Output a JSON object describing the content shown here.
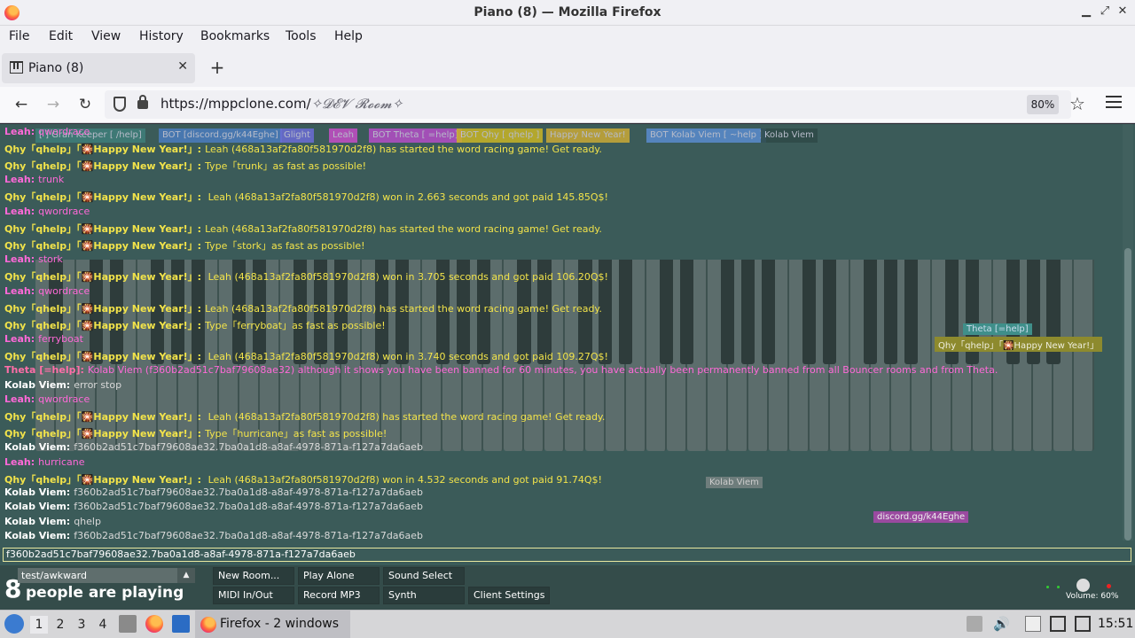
{
  "window": {
    "title": "Piano (8) — Mozilla Firefox"
  },
  "menu": [
    "File",
    "Edit",
    "View",
    "History",
    "Bookmarks",
    "Tools",
    "Help"
  ],
  "tab": {
    "title": "Piano (8)"
  },
  "nav": {
    "url_prefix": "https://mppclone.com/",
    "url_path": "✧𝓓𝓔𝓥 𝓡𝓸𝓸𝓶✧",
    "zoom": "80%"
  },
  "topbar_tags": [
    {
      "label": "[ ] Gran Keeper [ /help]",
      "color": "#3f7f7a"
    },
    {
      "label": "BOT [discord.gg/k44Eghe]",
      "color": "#4b7dbf"
    },
    {
      "label": "Glight",
      "color": "#6c6cd6"
    },
    {
      "label": "Leah",
      "color": "#c54ec7"
    },
    {
      "label": "BOT Theta [ =help]",
      "color": "#b54ec7"
    },
    {
      "label": "BOT Qhy [ qhelp ]",
      "color": "#c9b526"
    },
    {
      "label": "Happy New Year!",
      "color": "#caa936"
    },
    {
      "label": "BOT Kolab Viem [ ~help ]",
      "color": "#5a8ccf"
    },
    {
      "label": "Kolab Viem",
      "color": "#2f4a48"
    }
  ],
  "chat": [
    {
      "sender": "Leah:",
      "type": "leah",
      "message": "qwordrace",
      "style": "pink"
    },
    {
      "sender": "Qhy「qhelp」「🎇Happy New Year!」:",
      "type": "qhy",
      "message": "Leah (468a13af2fa80f581970d2f8) has started the word racing game! Get ready.",
      "style": "yellow"
    },
    {
      "sender": "Qhy「qhelp」「🎇Happy New Year!」:",
      "type": "qhy",
      "message": "Type「trunk」as fast as possible!",
      "style": "yellow"
    },
    {
      "sender": "Leah:",
      "type": "leah",
      "message": "trunk",
      "style": "pink"
    },
    {
      "sender": "Qhy「qhelp」「🎇Happy New Year!」:",
      "type": "qhy",
      "message": " Leah (468a13af2fa80f581970d2f8) won in 2.663 seconds and got paid 145.85Q$!",
      "style": "yellow"
    },
    {
      "sender": "Leah:",
      "type": "leah",
      "message": "qwordrace",
      "style": "pink"
    },
    {
      "sender": "Qhy「qhelp」「🎇Happy New Year!」:",
      "type": "qhy",
      "message": "Leah (468a13af2fa80f581970d2f8) has started the word racing game! Get ready.",
      "style": "yellow"
    },
    {
      "sender": "Qhy「qhelp」「🎇Happy New Year!」:",
      "type": "qhy",
      "message": "Type「stork」as fast as possible!",
      "style": "yellow"
    },
    {
      "sender": "Leah:",
      "type": "leah",
      "message": "stork",
      "style": "pink"
    },
    {
      "sender": "Qhy「qhelp」「🎇Happy New Year!」:",
      "type": "qhy",
      "message": " Leah (468a13af2fa80f581970d2f8) won in 3.705 seconds and got paid 106.20Q$!",
      "style": "yellow"
    },
    {
      "sender": "Leah:",
      "type": "leah",
      "message": "qwordrace",
      "style": "pink"
    },
    {
      "sender": "Qhy「qhelp」「🎇Happy New Year!」:",
      "type": "qhy",
      "message": "Leah (468a13af2fa80f581970d2f8) has started the word racing game! Get ready.",
      "style": "yellow"
    },
    {
      "sender": "Qhy「qhelp」「🎇Happy New Year!」:",
      "type": "qhy",
      "message": "Type「ferryboat」as fast as possible!",
      "style": "yellow"
    },
    {
      "sender": "Leah:",
      "type": "leah",
      "message": "ferryboat",
      "style": "pink"
    },
    {
      "sender": "Qhy「qhelp」「🎇Happy New Year!」:",
      "type": "qhy",
      "message": " Leah (468a13af2fa80f581970d2f8) won in 3.740 seconds and got paid 109.27Q$!",
      "style": "yellow"
    },
    {
      "sender": "Theta [=help]:",
      "type": "theta",
      "message": "Kolab Viem (f360b2ad51c7baf79608ae32) although it shows you have been banned for 60 minutes, you have actually been permanently banned from all Bouncer rooms and from Theta.",
      "style": "pink"
    },
    {
      "sender": "Kolab Viem:",
      "type": "kolab",
      "message": "error stop",
      "style": "grey"
    },
    {
      "sender": "Leah:",
      "type": "leah",
      "message": "qwordrace",
      "style": "pink"
    },
    {
      "sender": "Qhy「qhelp」「🎇Happy New Year!」:",
      "type": "qhy",
      "message": " Leah (468a13af2fa80f581970d2f8) has started the word racing game! Get ready.",
      "style": "yellow"
    },
    {
      "sender": "Qhy「qhelp」「🎇Happy New Year!」:",
      "type": "qhy",
      "message": "Type「hurricane」as fast as possible!",
      "style": "yellow"
    },
    {
      "sender": "Kolab Viem:",
      "type": "kolab",
      "message": "f360b2ad51c7baf79608ae32.7ba0a1d8-a8af-4978-871a-f127a7da6aeb",
      "style": "grey"
    },
    {
      "sender": "Leah:",
      "type": "leah",
      "message": "hurricane",
      "style": "pink"
    },
    {
      "sender": "Qhy「qhelp」「🎇Happy New Year!」:",
      "type": "qhy",
      "message": " Leah (468a13af2fa80f581970d2f8) won in 4.532 seconds and got paid 91.74Q$!",
      "style": "yellow"
    },
    {
      "sender": "Kolab Viem:",
      "type": "kolab",
      "message": "f360b2ad51c7baf79608ae32.7ba0a1d8-a8af-4978-871a-f127a7da6aeb",
      "style": "grey"
    },
    {
      "sender": "Kolab Viem:",
      "type": "kolab",
      "message": "f360b2ad51c7baf79608ae32.7ba0a1d8-a8af-4978-871a-f127a7da6aeb",
      "style": "grey"
    },
    {
      "sender": "Kolab Viem:",
      "type": "kolab",
      "message": "qhelp",
      "style": "grey"
    },
    {
      "sender": "Kolab Viem:",
      "type": "kolab",
      "message": "f360b2ad51c7baf79608ae32.7ba0a1d8-a8af-4978-871a-f127a7da6aeb",
      "style": "grey"
    }
  ],
  "floating_tags": [
    {
      "label": "Theta [=help]",
      "color": "#3f8f8a"
    },
    {
      "label": "Qhy「qhelp」「🎇Happy New Year!」",
      "color": "#a8a030"
    },
    {
      "label": "Kolab Viem",
      "color": "#6e7d7c"
    },
    {
      "label": "discord.gg/k44Eghe",
      "color": "#c54ec7"
    }
  ],
  "chat_input": {
    "value": "f360b2ad51c7baf79608ae32.7ba0a1d8-a8af-4978-871a-f127a7da6aeb"
  },
  "bottom": {
    "count": "8",
    "count_label": "people are playing",
    "room": "test/awkward",
    "buttons": [
      "New Room...",
      "Play Alone",
      "Sound Select",
      "MIDI In/Out",
      "Record MP3",
      "Synth",
      "Client Settings"
    ],
    "volume": "Volume: 60%"
  },
  "taskbar": {
    "workspaces": [
      "1",
      "2",
      "3",
      "4"
    ],
    "task_label": "Firefox - 2 windows",
    "clock": "15:51"
  },
  "colors": {
    "page_bg": "#3b5b59",
    "qhy_yellow": "#f2e34a",
    "leah_pink": "#ff69d8"
  }
}
